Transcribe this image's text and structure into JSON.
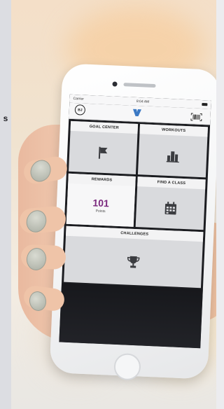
{
  "edge_label": "s",
  "phone": {
    "status_bar": {
      "carrier": "Carrier",
      "time": "8:04 AM"
    },
    "app_bar": {
      "avatar_initials": "BJ",
      "logo_icon": "y-logo-icon",
      "barcode_icon": "barcode-scan-icon"
    },
    "tiles": {
      "goal_center": {
        "label": "GOAL CENTER",
        "icon": "flag-icon"
      },
      "workouts": {
        "label": "WORKOUTS",
        "icon": "bar-chart-icon"
      },
      "rewards": {
        "label": "REWARDS",
        "points_value": "101",
        "points_label": "Points"
      },
      "find_a_class": {
        "label": "FIND A CLASS",
        "icon": "calendar-icon"
      },
      "challenges": {
        "label": "CHALLENGES",
        "icon": "trophy-icon"
      }
    }
  },
  "colors": {
    "accent_purple": "#7b2a7e",
    "logo_blue": "#3b79c4",
    "tile_bg": "#d9dadd",
    "header_bg": "#f3f3f4"
  }
}
